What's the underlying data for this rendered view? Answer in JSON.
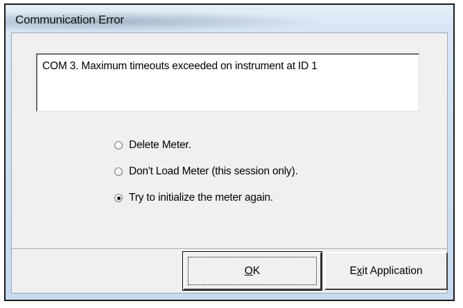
{
  "window": {
    "title": "Communication Error"
  },
  "message": {
    "text": "COM 3. Maximum timeouts exceeded on instrument at ID 1"
  },
  "options": [
    {
      "label": "Delete Meter.",
      "checked": false
    },
    {
      "label": "Don't Load Meter (this session only).",
      "checked": false
    },
    {
      "label": "Try to initialize the meter again.",
      "checked": true
    }
  ],
  "buttons": {
    "ok": {
      "label": "OK",
      "mnemonic": "O",
      "rest": "K"
    },
    "exit": {
      "label": "Exit Application",
      "prefix": "E",
      "mnemonic": "x",
      "rest": "it Application"
    }
  }
}
